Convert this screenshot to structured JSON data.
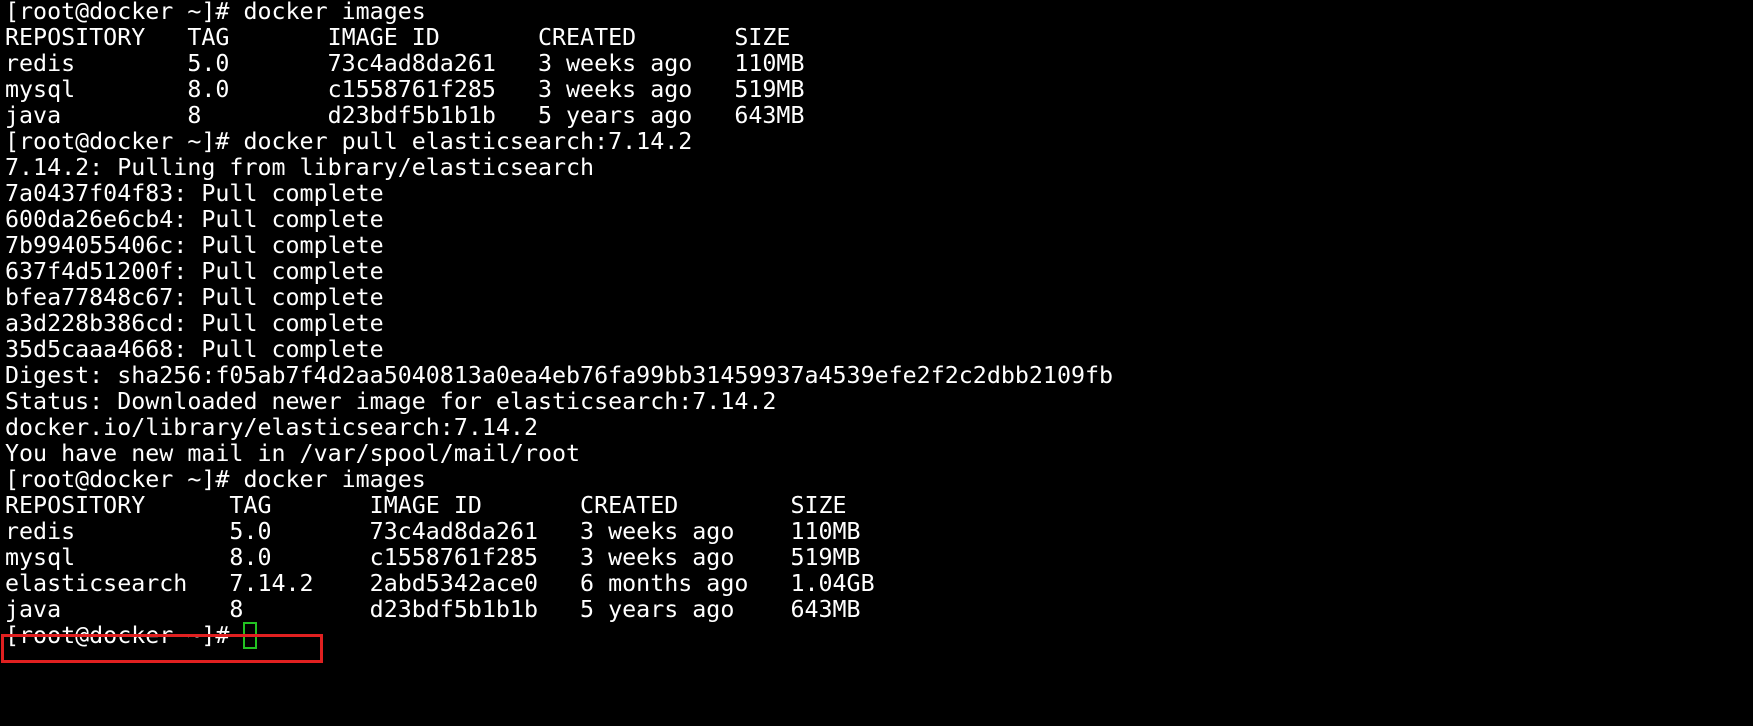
{
  "terminal": {
    "lines": [
      "[root@docker ~]# docker images",
      "REPOSITORY   TAG       IMAGE ID       CREATED       SIZE",
      "redis        5.0       73c4ad8da261   3 weeks ago   110MB",
      "mysql        8.0       c1558761f285   3 weeks ago   519MB",
      "java         8         d23bdf5b1b1b   5 years ago   643MB",
      "[root@docker ~]# docker pull elasticsearch:7.14.2",
      "7.14.2: Pulling from library/elasticsearch",
      "7a0437f04f83: Pull complete",
      "600da26e6cb4: Pull complete",
      "7b994055406c: Pull complete",
      "637f4d51200f: Pull complete",
      "bfea77848c67: Pull complete",
      "a3d228b386cd: Pull complete",
      "35d5caaa4668: Pull complete",
      "Digest: sha256:f05ab7f4d2aa5040813a0ea4eb76fa99bb31459937a4539efe2f2c2dbb2109fb",
      "Status: Downloaded newer image for elasticsearch:7.14.2",
      "docker.io/library/elasticsearch:7.14.2",
      "You have new mail in /var/spool/mail/root",
      "[root@docker ~]# docker images",
      "REPOSITORY      TAG       IMAGE ID       CREATED        SIZE",
      "redis           5.0       73c4ad8da261   3 weeks ago    110MB",
      "mysql           8.0       c1558761f285   3 weeks ago    519MB",
      "elasticsearch   7.14.2    2abd5342ace0   6 months ago   1.04GB",
      "java            8         d23bdf5b1b1b   5 years ago    643MB"
    ],
    "prompt": "[root@docker ~]# ",
    "highlighted_row_index": 22,
    "colors": {
      "background": "#000000",
      "text": "#ffffff",
      "highlight_border": "#e02020",
      "cursor": "#22c222"
    }
  }
}
